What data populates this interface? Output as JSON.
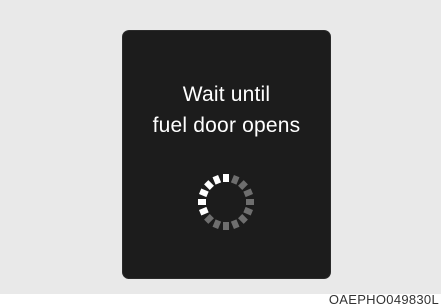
{
  "display": {
    "message_line1": "Wait until",
    "message_line2": "fuel door opens",
    "spinner": {
      "icon": "loading-spinner-icon",
      "segments": 16,
      "bright_color": "#ffffff",
      "dim_color": "#6e6e6e"
    }
  },
  "figure_code": "OAEPHO049830L",
  "colors": {
    "panel_background": "#1c1c1c",
    "page_background": "#e9e9e9",
    "text": "#ffffff"
  }
}
